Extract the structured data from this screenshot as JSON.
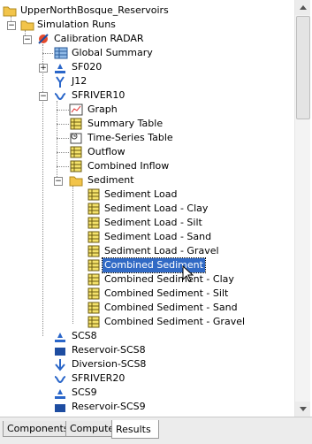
{
  "tree": {
    "root": "UpperNorthBosque_Reservoirs",
    "simulation_runs": "Simulation Runs",
    "calibration": "Calibration RADAR",
    "global_summary": "Global Summary",
    "sf020": "SF020",
    "j12": "J12",
    "sfriver10": "SFRIVER10",
    "graph": "Graph",
    "summary_table": "Summary Table",
    "time_series_table": "Time-Series Table",
    "outflow": "Outflow",
    "combined_inflow": "Combined Inflow",
    "sediment": "Sediment",
    "sediment_load": "Sediment Load",
    "sediment_load_clay": "Sediment Load - Clay",
    "sediment_load_silt": "Sediment Load - Silt",
    "sediment_load_sand": "Sediment Load - Sand",
    "sediment_load_gravel": "Sediment Load - Gravel",
    "combined_sediment": "Combined Sediment",
    "combined_sediment_clay": "Combined Sediment - Clay",
    "combined_sediment_silt": "Combined Sediment - Silt",
    "combined_sediment_sand": "Combined Sediment - Sand",
    "combined_sediment_gravel": "Combined Sediment - Gravel",
    "scs8": "SCS8",
    "reservoir_scs8": "Reservoir-SCS8",
    "diversion_scs8": "Diversion-SCS8",
    "sfriver20": "SFRIVER20",
    "scs9": "SCS9",
    "reservoir_scs9": "Reservoir-SCS9"
  },
  "tabs": {
    "components": "Components",
    "compute": "Compute",
    "results": "Results"
  },
  "colors": {
    "selection": "#316ac5",
    "folder": "#f2c44a",
    "table_icon": "#f4e26b"
  }
}
